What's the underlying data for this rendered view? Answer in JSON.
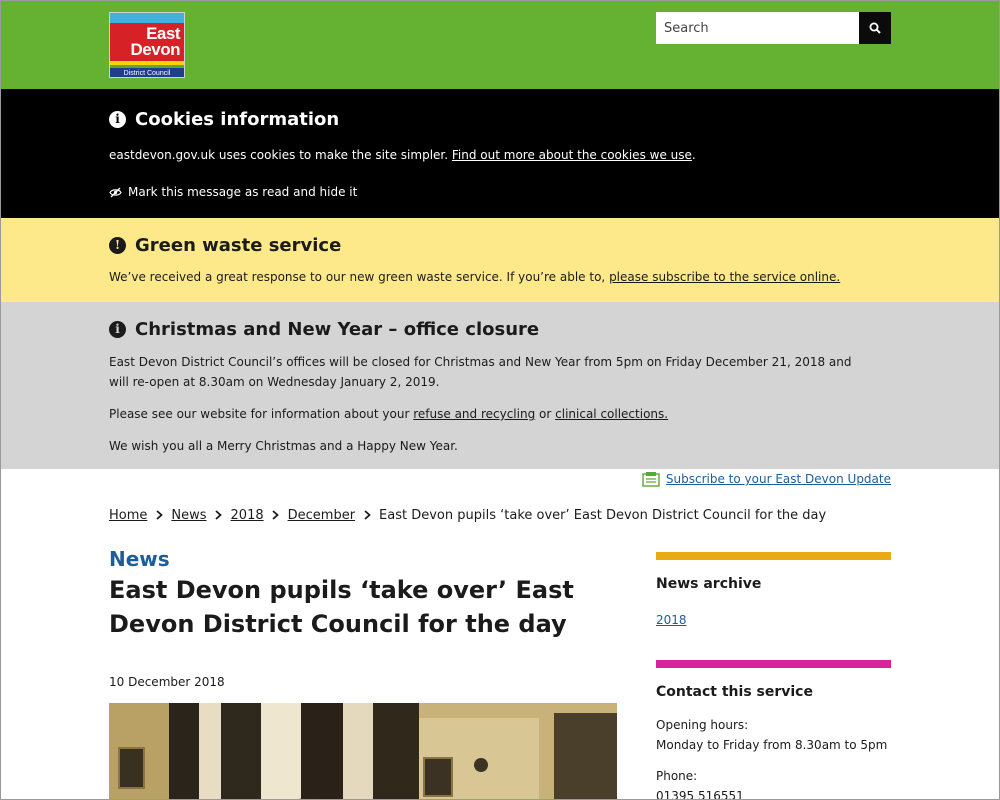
{
  "header": {
    "logo": {
      "line1": "East",
      "line2": "Devon",
      "line3": "District Council"
    },
    "search": {
      "placeholder": "Search"
    },
    "colors": {
      "header_bg": "#65b232"
    }
  },
  "cookies": {
    "title": "Cookies information",
    "text": "eastdevon.gov.uk uses cookies to make the site simpler.",
    "link": "Find out more about the cookies we use",
    "text_end": ".",
    "mark_label": "Mark this message as read and hide it"
  },
  "green_waste": {
    "title": "Green waste service",
    "text": "We’ve received a great response to our new green waste service. If you’re able to,",
    "link": "please subscribe to the service online."
  },
  "xmas": {
    "title": "Christmas and New Year – office closure",
    "p1": "East Devon District Council’s offices will be closed for Christmas and New Year from 5pm on Friday December 21, 2018 and will re-open at 8.30am on Wednesday January 2, 2019.",
    "p2_start": "Please see our website for information about your",
    "p2_link1": "refuse and recycling",
    "p2_mid": "or",
    "p2_link2": "clinical collections.",
    "p3": "We wish you all a Merry Christmas and a Happy New Year."
  },
  "subscribe": {
    "label": "Subscribe to your East Devon Update"
  },
  "breadcrumb": {
    "items": [
      "Home",
      "News",
      "2018",
      "December"
    ],
    "current": "East Devon pupils ‘take over’ East Devon District Council for the day"
  },
  "article": {
    "section": "News",
    "title": "East Devon pupils ‘take over’ East Devon District Council for the day",
    "date": "10 December 2018"
  },
  "sidebar": {
    "archive": {
      "title": "News archive",
      "link": "2018",
      "bar_color": "#e8ab14"
    },
    "contact": {
      "title": "Contact this service",
      "hours_label": "Opening hours:",
      "hours_value": "Monday to Friday from 8.30am to 5pm",
      "phone_label": "Phone:",
      "phone_value": "01395 516551",
      "bar_color": "#d6259a"
    }
  }
}
